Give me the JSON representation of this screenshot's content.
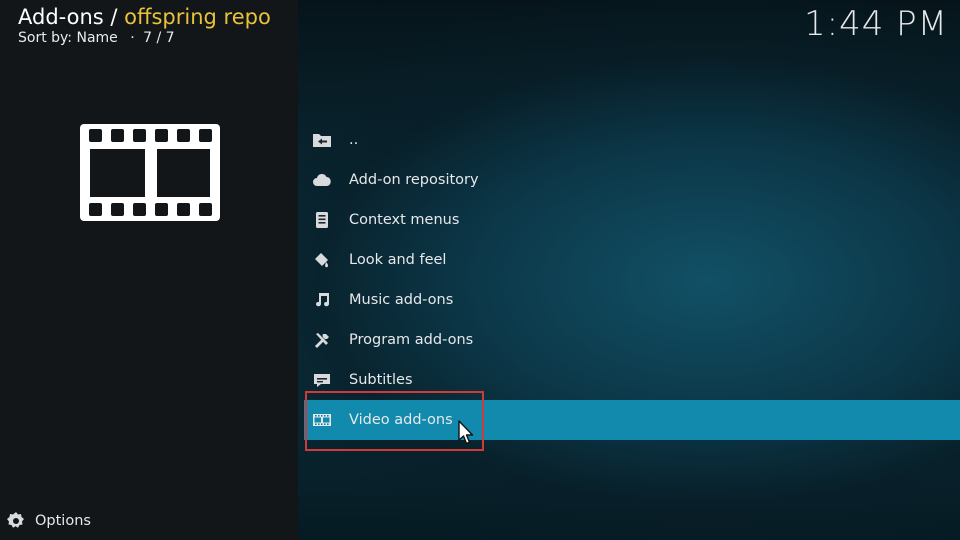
{
  "header": {
    "title_prefix": "Add-ons / ",
    "title_accent": "offspring repo",
    "sort_text": "Sort by: Name",
    "separator": "·",
    "count": "7 / 7"
  },
  "clock": "1:44 PM",
  "thumbnail_icon": "film-strip-icon",
  "items": [
    {
      "label": "..",
      "icon": "folder-back-icon"
    },
    {
      "label": "Add-on repository",
      "icon": "cloud-icon"
    },
    {
      "label": "Context menus",
      "icon": "context-menu-icon"
    },
    {
      "label": "Look and feel",
      "icon": "paint-bucket-icon"
    },
    {
      "label": "Music add-ons",
      "icon": "music-note-icon"
    },
    {
      "label": "Program add-ons",
      "icon": "tools-icon"
    },
    {
      "label": "Subtitles",
      "icon": "subtitles-icon"
    },
    {
      "label": "Video add-ons",
      "icon": "film-icon",
      "selected": true
    }
  ],
  "footer": {
    "options_label": "Options",
    "options_icon": "options-gear-icon"
  },
  "colors": {
    "accent": "#e8c23b",
    "selection": "#128aad",
    "annotation_box": "#d23a3a"
  }
}
